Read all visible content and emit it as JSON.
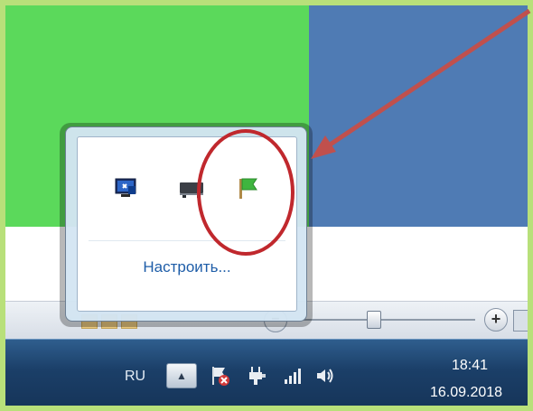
{
  "colors": {
    "frame_bg": "#b8e07a",
    "green_panel": "#5bd95b",
    "blue_panel": "#4f7bb4",
    "taskbar": "#1b3f68",
    "link": "#1e5da8",
    "annotation_red": "#c0282d",
    "arrow_red": "#c0504d"
  },
  "popup": {
    "icons": [
      "network-monitor-icon",
      "display-devices-icon",
      "action-center-flag-icon"
    ],
    "customize_label": "Настроить..."
  },
  "statusbar": {
    "zoom_minus_label": "−",
    "zoom_plus_label": "+"
  },
  "taskbar": {
    "language": "RU",
    "show_hidden_label": "▲",
    "tray_icons": [
      "action-center-error-icon",
      "power-plug-icon",
      "network-signal-icon",
      "volume-icon"
    ],
    "clock": {
      "time": "18:41",
      "date": "16.09.2018"
    }
  }
}
